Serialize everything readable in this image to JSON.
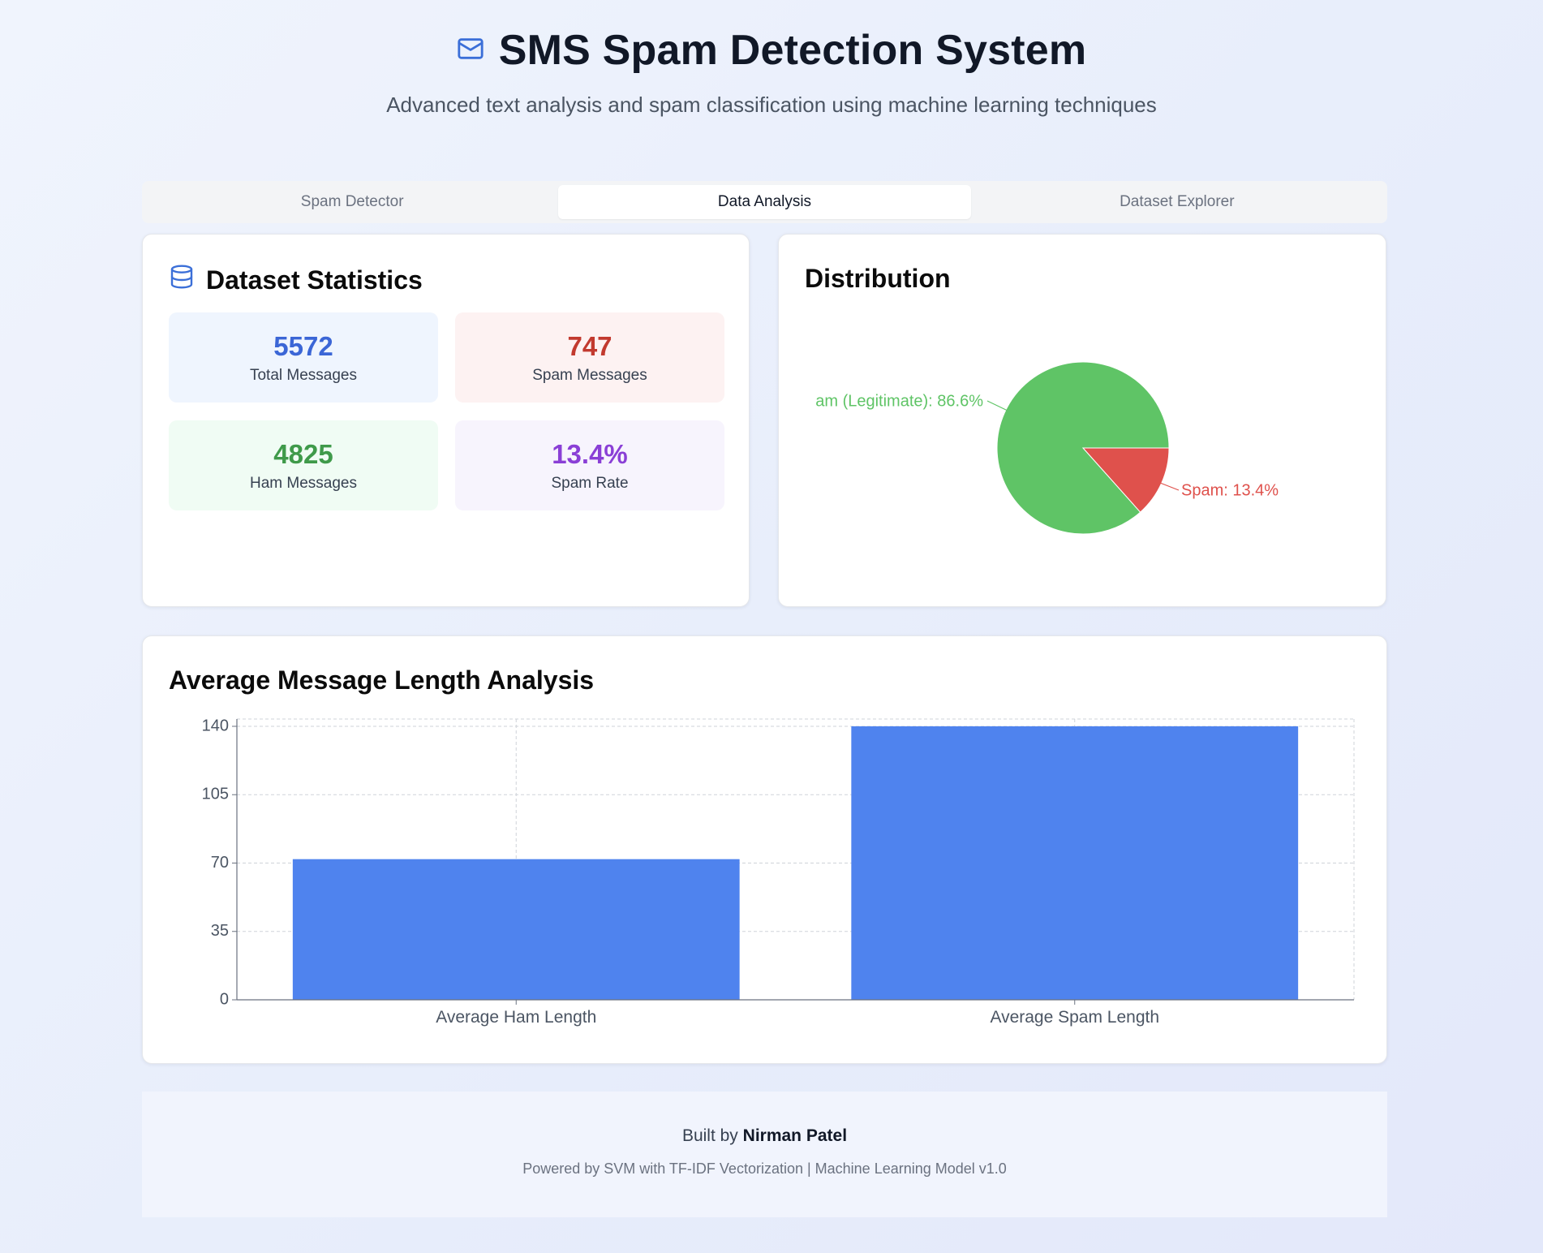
{
  "header": {
    "title": "SMS Spam Detection System",
    "subtitle": "Advanced text analysis and spam classification using machine learning techniques",
    "icon": "mail-icon"
  },
  "tabs": [
    {
      "label": "Spam Detector",
      "active": false
    },
    {
      "label": "Data Analysis",
      "active": true
    },
    {
      "label": "Dataset Explorer",
      "active": false
    }
  ],
  "stats_card": {
    "title": "Dataset Statistics",
    "icon": "database-icon",
    "items": [
      {
        "value": "5572",
        "label": "Total Messages",
        "color": "#3b66d6",
        "bg": "#eff5fe"
      },
      {
        "value": "747",
        "label": "Spam Messages",
        "color": "#c23a2f",
        "bg": "#fdf2f2"
      },
      {
        "value": "4825",
        "label": "Ham Messages",
        "color": "#3f9a4a",
        "bg": "#f0fcf4"
      },
      {
        "value": "13.4%",
        "label": "Spam Rate",
        "color": "#8a3fd6",
        "bg": "#f7f4fd"
      }
    ]
  },
  "distribution_card": {
    "title": "Distribution",
    "chart_data": {
      "type": "pie",
      "slices": [
        {
          "label": "am (Legitimate): 86.6%",
          "value": 86.6,
          "color": "#5fc466"
        },
        {
          "label": "Spam: 13.4%",
          "value": 13.4,
          "color": "#df514c"
        }
      ]
    }
  },
  "length_card": {
    "title": "Average Message Length Analysis",
    "chart_data": {
      "type": "bar",
      "categories": [
        "Average Ham Length",
        "Average Spam Length"
      ],
      "values": [
        72,
        140
      ],
      "ylim": [
        0,
        140
      ],
      "yticks": [
        "0",
        "35",
        "70",
        "105",
        "140"
      ],
      "grid": true,
      "bar_color": "#4f83ee"
    }
  },
  "footer": {
    "built_prefix": "Built by",
    "author": "Nirman Patel",
    "powered": "Powered by SVM with TF-IDF Vectorization | Machine Learning Model v1.0"
  }
}
